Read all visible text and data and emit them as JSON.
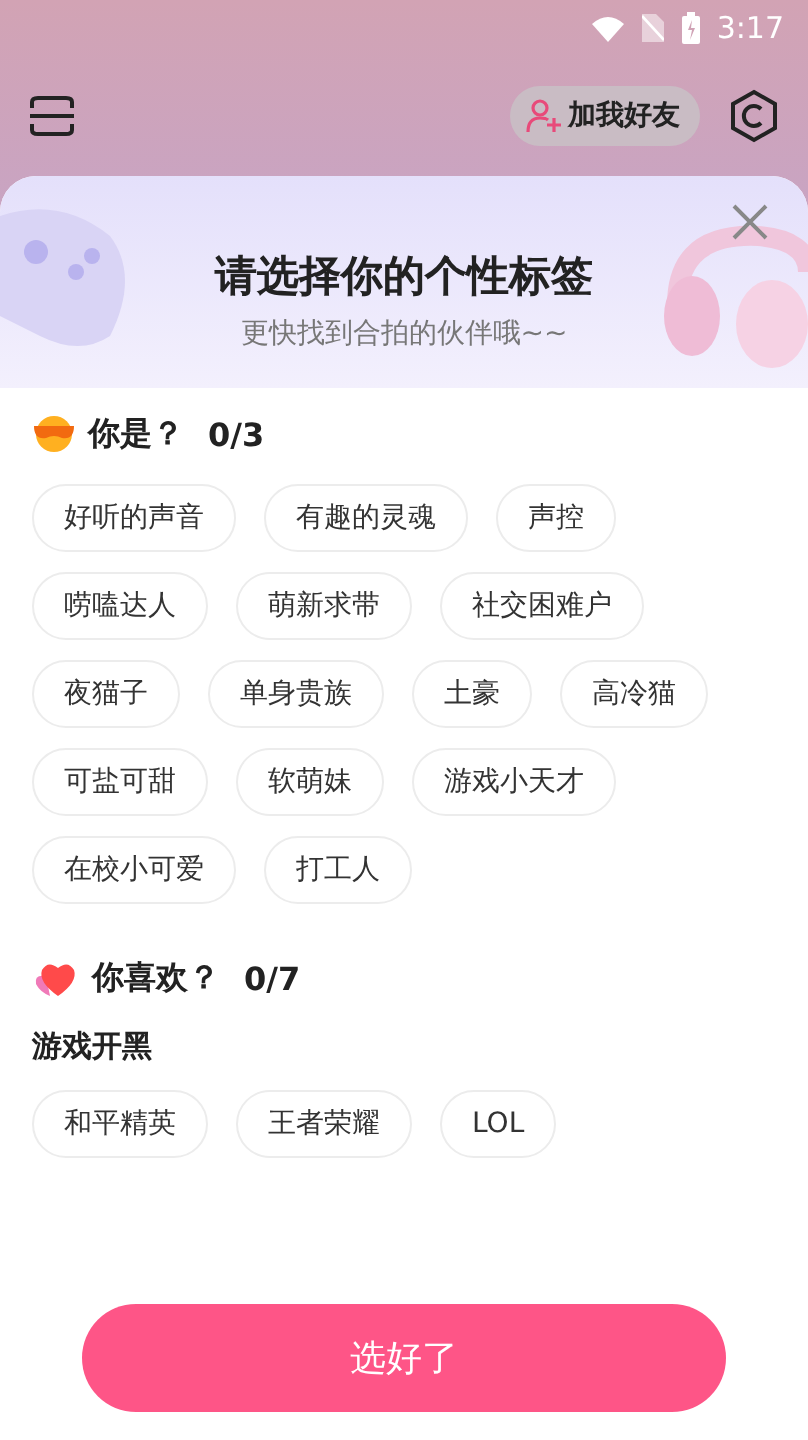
{
  "status_bar": {
    "time": "3:17"
  },
  "header": {
    "add_friend_button": "加我好友"
  },
  "banner": {
    "title": "请选择你的个性标签",
    "subtitle": "更快找到合拍的伙伴哦~~"
  },
  "sections": [
    {
      "kind": "sunglasses",
      "title": "你是？",
      "count": "0/3",
      "groups": [
        {
          "tags": [
            {
              "label": "好听的声音",
              "selected": false
            },
            {
              "label": "有趣的灵魂",
              "selected": false
            },
            {
              "label": "声控",
              "selected": false
            },
            {
              "label": "唠嗑达人",
              "selected": false
            },
            {
              "label": "萌新求带",
              "selected": false
            },
            {
              "label": "社交困难户",
              "selected": false
            },
            {
              "label": "夜猫子",
              "selected": false
            },
            {
              "label": "单身贵族",
              "selected": false
            },
            {
              "label": "土豪",
              "selected": false
            },
            {
              "label": "高冷猫",
              "selected": false
            },
            {
              "label": "可盐可甜",
              "selected": false
            },
            {
              "label": "软萌妹",
              "selected": false
            },
            {
              "label": "游戏小天才",
              "selected": false
            },
            {
              "label": "在校小可爱",
              "selected": false
            },
            {
              "label": "打工人",
              "selected": false
            }
          ]
        }
      ]
    },
    {
      "kind": "heart",
      "title": "你喜欢？",
      "count": "0/7",
      "groups": [
        {
          "title": "游戏开黑",
          "tags": [
            {
              "label": "和平精英",
              "selected": false
            },
            {
              "label": "王者荣耀",
              "selected": false
            },
            {
              "label": "LOL",
              "selected": false
            }
          ]
        }
      ]
    }
  ],
  "confirm_button": "选好了"
}
